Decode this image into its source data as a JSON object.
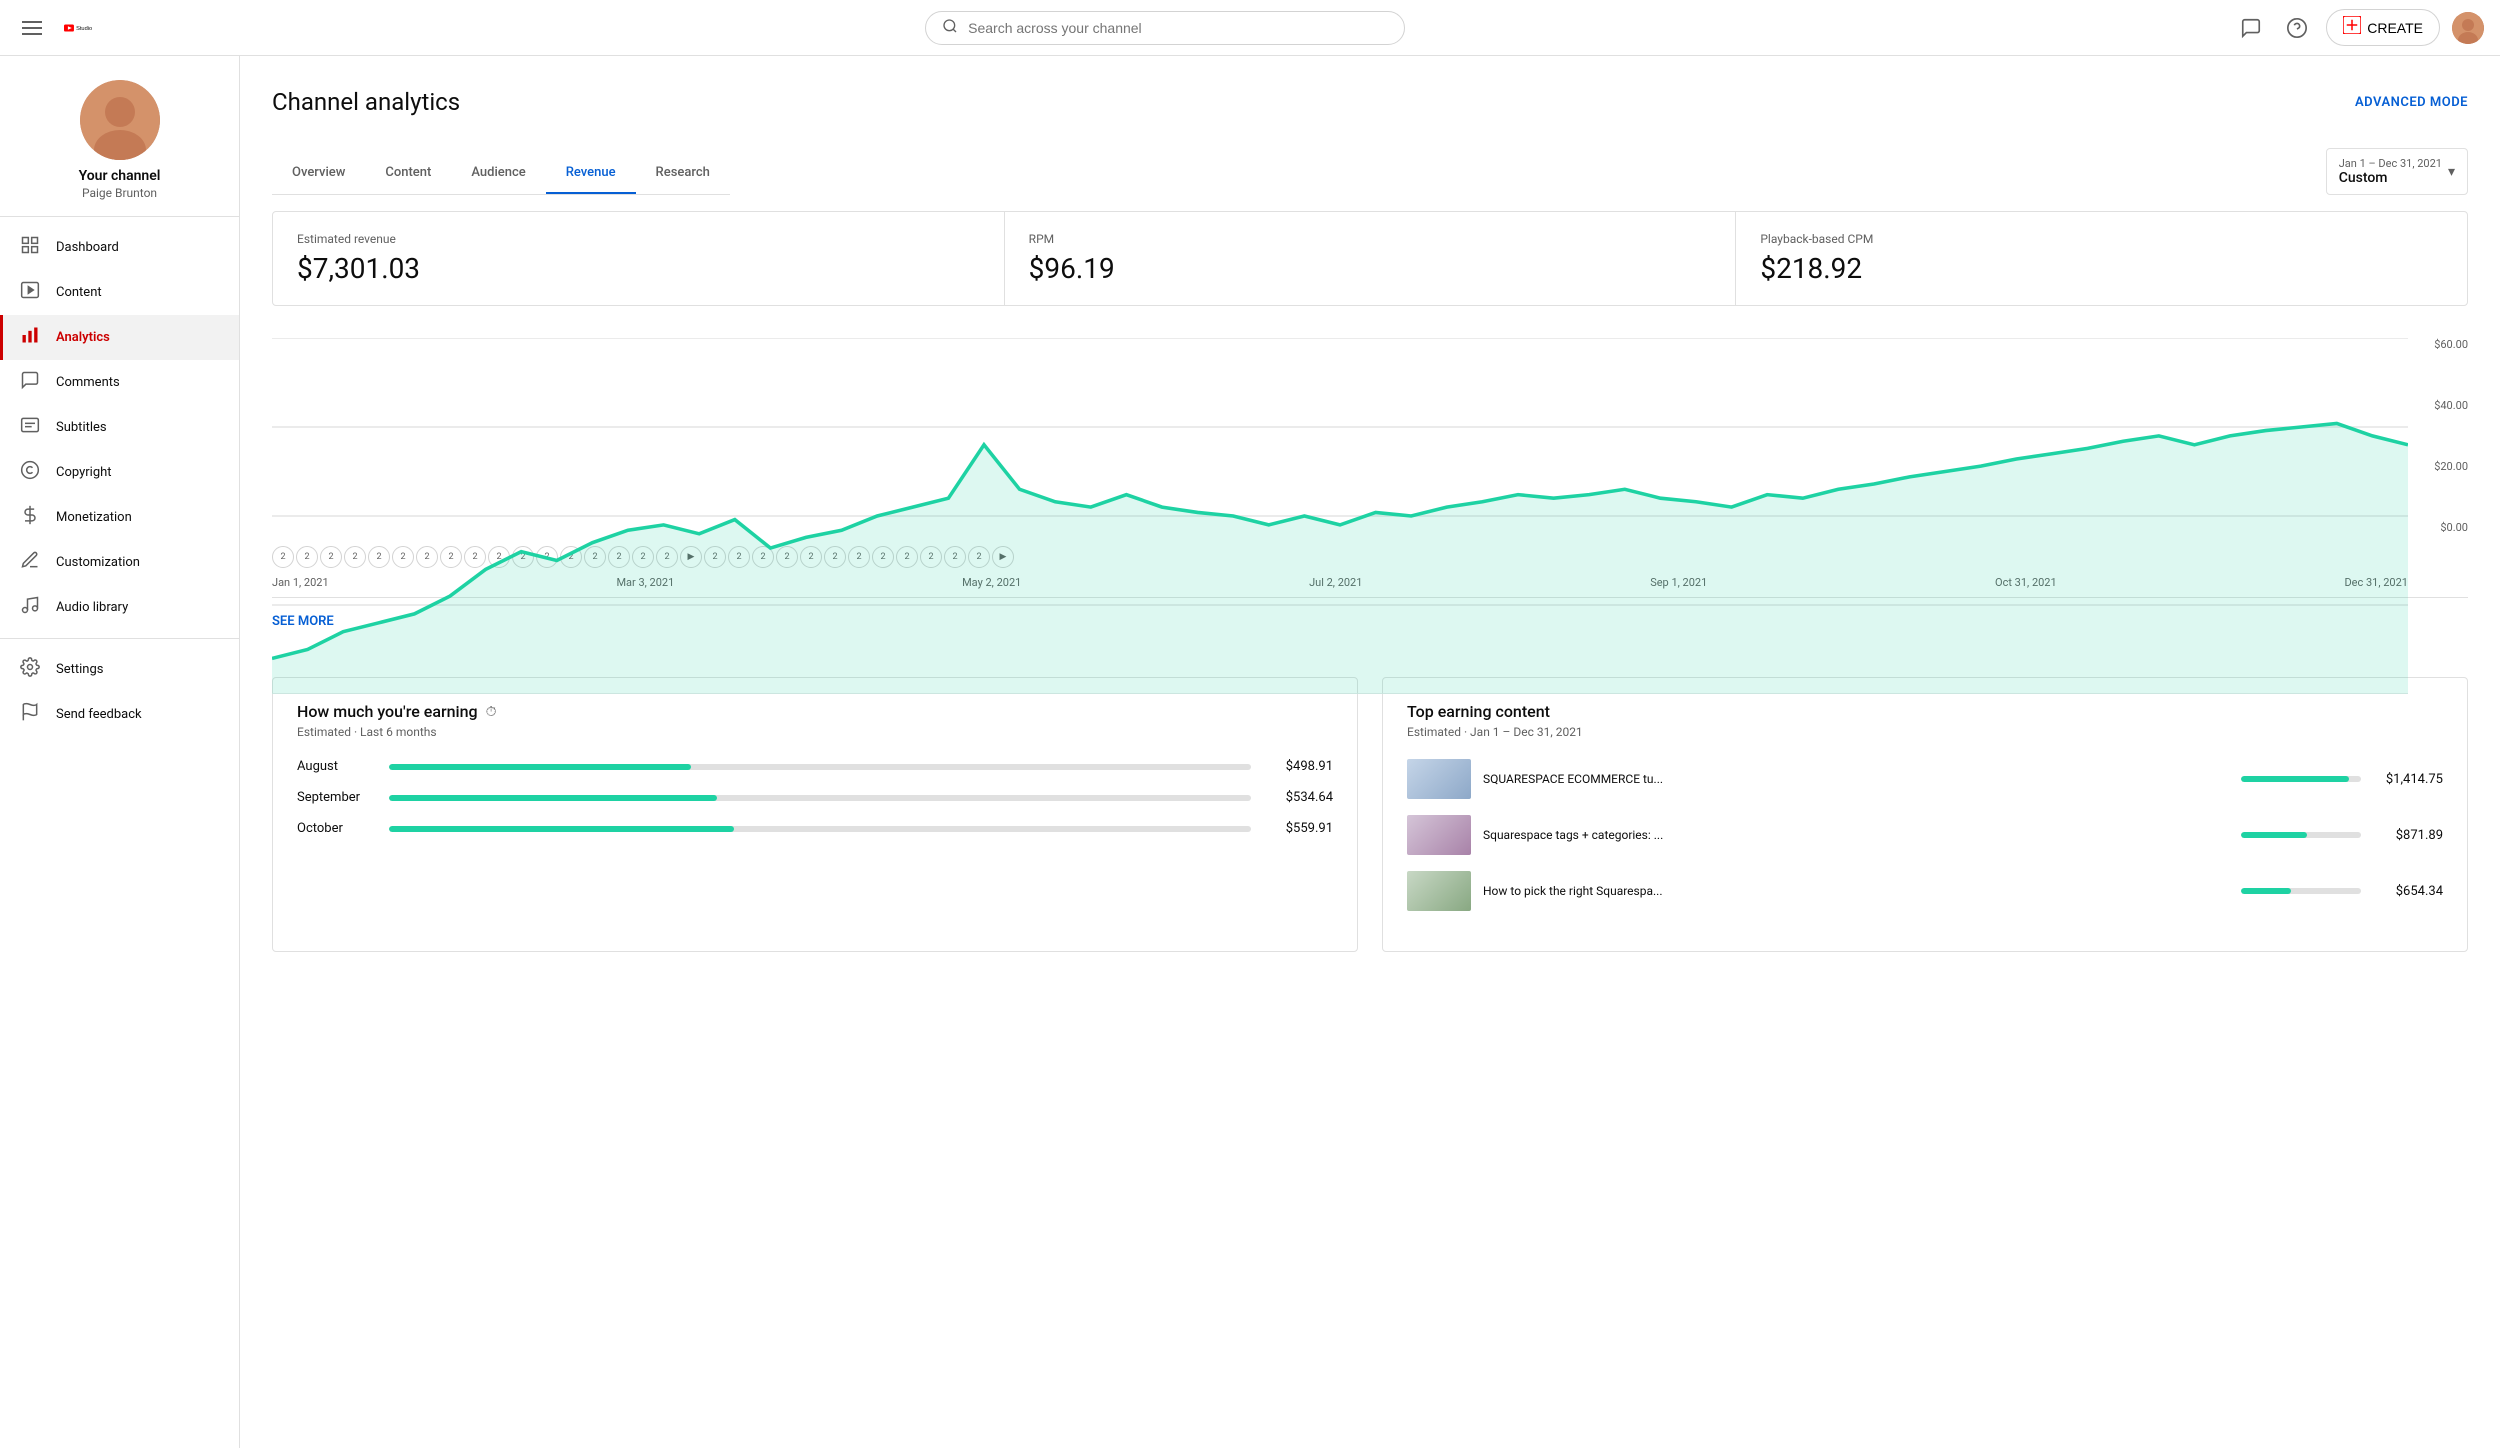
{
  "header": {
    "search_placeholder": "Search across your channel",
    "create_label": "CREATE",
    "logo_text": "Studio"
  },
  "sidebar": {
    "channel_name": "Your channel",
    "channel_handle": "Paige Brunton",
    "nav_items": [
      {
        "id": "dashboard",
        "label": "Dashboard",
        "icon": "⊞"
      },
      {
        "id": "content",
        "label": "Content",
        "icon": "▶"
      },
      {
        "id": "analytics",
        "label": "Analytics",
        "icon": "📊",
        "active": true
      },
      {
        "id": "comments",
        "label": "Comments",
        "icon": "💬"
      },
      {
        "id": "subtitles",
        "label": "Subtitles",
        "icon": "🗒"
      },
      {
        "id": "copyright",
        "label": "Copyright",
        "icon": "©"
      },
      {
        "id": "monetization",
        "label": "Monetization",
        "icon": "$"
      },
      {
        "id": "customization",
        "label": "Customization",
        "icon": "✏"
      },
      {
        "id": "audio-library",
        "label": "Audio library",
        "icon": "♫"
      }
    ],
    "nav_items_bottom": [
      {
        "id": "settings",
        "label": "Settings",
        "icon": "⚙"
      },
      {
        "id": "send-feedback",
        "label": "Send feedback",
        "icon": "⚑"
      }
    ]
  },
  "analytics": {
    "page_title": "Channel analytics",
    "advanced_mode_label": "ADVANCED MODE",
    "date_range_top": "Jan 1 – Dec 31, 2021",
    "date_range_label": "Custom",
    "tabs": [
      {
        "id": "overview",
        "label": "Overview"
      },
      {
        "id": "content",
        "label": "Content"
      },
      {
        "id": "audience",
        "label": "Audience"
      },
      {
        "id": "revenue",
        "label": "Revenue",
        "active": true
      },
      {
        "id": "research",
        "label": "Research"
      }
    ],
    "stats": [
      {
        "label": "Estimated revenue",
        "value": "$7,301.03"
      },
      {
        "label": "RPM",
        "value": "$96.19"
      },
      {
        "label": "Playback-based CPM",
        "value": "$218.92"
      }
    ],
    "chart": {
      "y_labels": [
        "$60.00",
        "$40.00",
        "$20.00",
        "$0.00"
      ],
      "x_labels": [
        "Jan 1, 2021",
        "Mar 3, 2021",
        "May 2, 2021",
        "Jul 2, 2021",
        "Sep 1, 2021",
        "Oct 31, 2021",
        "Dec 31, 2021"
      ],
      "timeline_items": [
        "2",
        "2",
        "2",
        "2",
        "2",
        "2",
        "2",
        "2",
        "2",
        "2",
        "2",
        "2",
        "2",
        "2",
        "2",
        "2",
        "2",
        "▶",
        "2",
        "2",
        "2",
        "2",
        "2",
        "2",
        "2",
        "2",
        "2",
        "2",
        "2",
        "2",
        "▶"
      ]
    },
    "see_more_label": "SEE MORE",
    "earning_card": {
      "title": "How much you're earning",
      "subtitle": "Estimated · Last 6 months",
      "rows": [
        {
          "month": "August",
          "value": "$498.91",
          "pct": 35
        },
        {
          "month": "September",
          "value": "$534.64",
          "pct": 38
        },
        {
          "month": "October",
          "value": "$559.91",
          "pct": 40
        }
      ]
    },
    "top_earning_card": {
      "title": "Top earning content",
      "subtitle": "Estimated · Jan 1 – Dec 31, 2021",
      "rows": [
        {
          "title": "SQUARESPACE ECOMMERCE tu...",
          "value": "$1,414.75",
          "pct": 90
        },
        {
          "title": "Squarespace tags + categories: ...",
          "value": "$871.89",
          "pct": 55
        },
        {
          "title": "How to pick the right Squarespa...",
          "value": "$654.34",
          "pct": 42
        }
      ]
    }
  }
}
